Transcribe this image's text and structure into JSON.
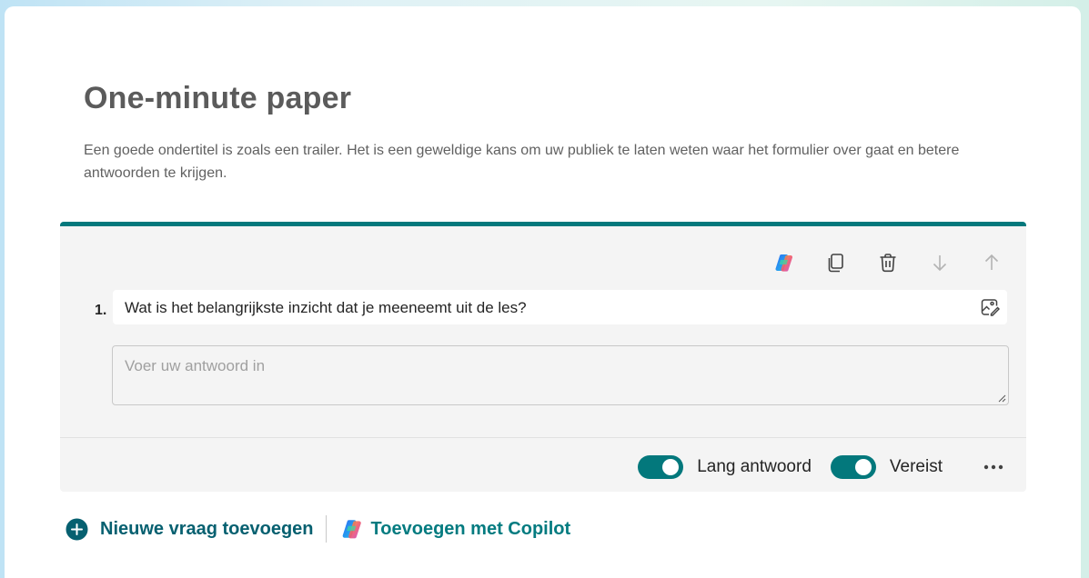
{
  "form": {
    "title": "One-minute paper",
    "subtitle": "Een goede ondertitel is zoals een trailer. Het is een geweldige kans om uw publiek te laten weten waar het formulier over gaat en betere antwoorden te krijgen."
  },
  "question": {
    "number": "1.",
    "title": "Wat is het belangrijkste inzicht dat je meeneemt uit de les?",
    "answer_placeholder": "Voer uw antwoord in",
    "toolbar": {
      "icons": [
        "copilot-icon",
        "copy-icon",
        "delete-icon",
        "move-down-icon",
        "move-up-icon"
      ]
    },
    "options": {
      "long_answer_label": "Lang antwoord",
      "long_answer_enabled": true,
      "required_label": "Vereist",
      "required_enabled": true
    }
  },
  "actions": {
    "add_question_label": "Nieuwe vraag toevoegen",
    "add_with_copilot_label": "Toevoegen met Copilot"
  },
  "colors": {
    "accent": "#03787c",
    "accent_text": "#066070",
    "card_bg": "#f4f4f4"
  }
}
